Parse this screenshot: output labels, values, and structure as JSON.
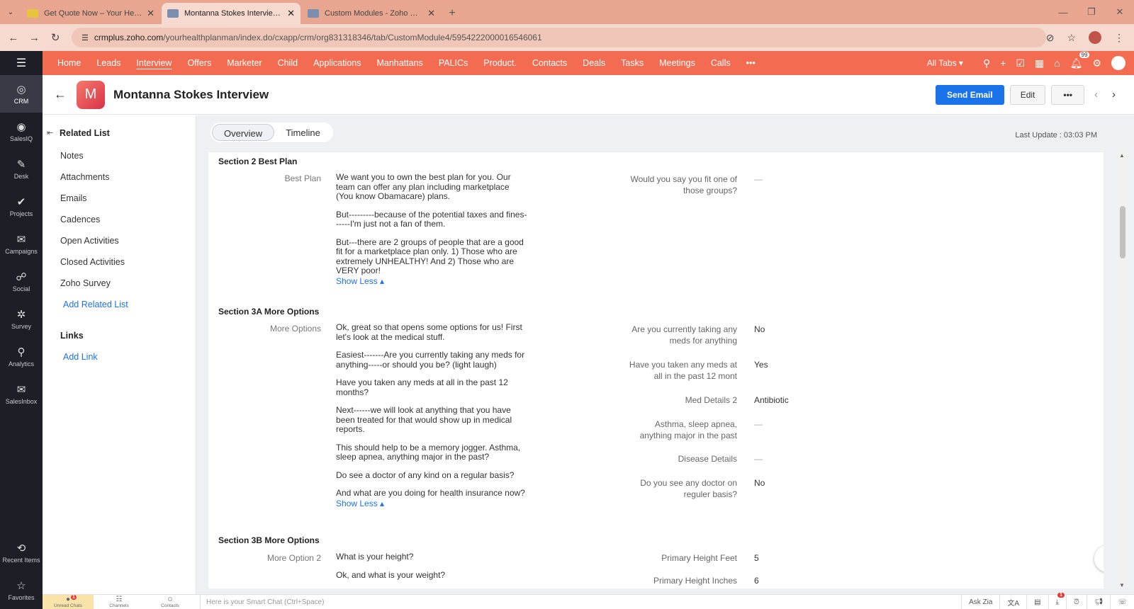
{
  "browser": {
    "tabs": [
      {
        "title": "Get Quote Now – Your Health P",
        "active": false,
        "fav_color": "#e8c33c"
      },
      {
        "title": "Montanna Stokes Interview (Int",
        "active": true,
        "fav_color": "#7a8fb0"
      },
      {
        "title": "Custom Modules - Zoho CRM",
        "active": false,
        "fav_color": "#7a8fb0"
      }
    ],
    "url_host": "crmplus.zoho.com",
    "url_path": "/yourhealthplanman/index.do/cxapp/crm/org831318346/tab/CustomModule4/5954222000016546061"
  },
  "topnav": {
    "items": [
      "Home",
      "Leads",
      "Interview",
      "Offers",
      "Marketer",
      "Child",
      "Applications",
      "Manhattans",
      "PALICs",
      "Product.",
      "Contacts",
      "Deals",
      "Tasks",
      "Meetings",
      "Calls"
    ],
    "active": "Interview",
    "more": "•••",
    "all_tabs": "All Tabs ▾",
    "notif_count": "99"
  },
  "sidebar": {
    "items": [
      {
        "label": "CRM",
        "icon": "◎",
        "active": true
      },
      {
        "label": "SalesIQ",
        "icon": "◉",
        "active": false
      },
      {
        "label": "Desk",
        "icon": "✎",
        "active": false
      },
      {
        "label": "Projects",
        "icon": "✔",
        "active": false
      },
      {
        "label": "Campaigns",
        "icon": "✉",
        "active": false
      },
      {
        "label": "Social",
        "icon": "☍",
        "active": false
      },
      {
        "label": "Survey",
        "icon": "✲",
        "active": false
      },
      {
        "label": "Analytics",
        "icon": "⚲",
        "active": false
      },
      {
        "label": "SalesInbox",
        "icon": "✉",
        "active": false
      }
    ],
    "bottom": [
      {
        "label": "Recent Items",
        "icon": "⟲"
      },
      {
        "label": "Favorites",
        "icon": "☆"
      }
    ]
  },
  "record": {
    "avatar_letter": "M",
    "title": "Montanna Stokes Interview",
    "send_email": "Send Email",
    "edit": "Edit",
    "more": "•••"
  },
  "related": {
    "title": "Related List",
    "items": [
      "Notes",
      "Attachments",
      "Emails",
      "Cadences",
      "Open Activities",
      "Closed Activities",
      "Zoho Survey"
    ],
    "add_related": "Add Related List",
    "links_title": "Links",
    "add_link": "Add Link"
  },
  "view_tabs": {
    "overview": "Overview",
    "timeline": "Timeline"
  },
  "last_update": "Last Update : 03:03 PM",
  "sections": {
    "s2": {
      "title": "Section 2 Best Plan",
      "label": "Best Plan",
      "paras": [
        "We want you to own the best plan for you. Our team can offer any plan including marketplace (You know Obamacare) plans.",
        "But---------because of the potential taxes and fines------I'm just not a fan of them.",
        "But---there are 2 groups of people that are a good fit for a marketplace plan only. 1) Those who are extremely UNHEALTHY! And 2) Those who are VERY poor!"
      ],
      "show_less": "Show Less ▴",
      "right": [
        {
          "label": "Would you say you fit one of those groups?",
          "value": "—"
        }
      ]
    },
    "s3a": {
      "title": "Section 3A More Options",
      "label": "More Options",
      "paras": [
        "Ok, great so that opens some options for us! First let's look at the medical stuff.",
        "Easiest-------Are you currently taking any meds for anything-----or should you be? (light laugh)",
        "Have you taken any meds at all in the past 12 months?",
        "Next------we will look at anything that you have been treated for that would show up in medical reports.",
        "This should help to be a memory jogger. Asthma, sleep apnea, anything major in the past?",
        "Do see a doctor of any kind on a regular basis?",
        "And what are you doing for health insurance now?"
      ],
      "show_less": "Show Less ▴",
      "right": [
        {
          "label": "Are you currently taking any meds for anything",
          "value": "No"
        },
        {
          "label": "Have you taken any meds at all in the past 12 mont",
          "value": "Yes"
        },
        {
          "label": "Med Details 2",
          "value": "Antibiotic"
        },
        {
          "label": "Asthma, sleep apnea, anything major in the past",
          "value": "—"
        },
        {
          "label": "Disease Details",
          "value": "—"
        },
        {
          "label": "Do you see any doctor on reguler basis?",
          "value": "No"
        }
      ]
    },
    "s3b": {
      "title": "Section 3B More Options",
      "label": "More Option 2",
      "paras": [
        "What is your height?",
        "Ok, and what is your weight?"
      ],
      "right": [
        {
          "label": "Primary Height Feet",
          "value": "5"
        },
        {
          "label": "Primary Height Inches",
          "value": "6"
        }
      ]
    }
  },
  "bottombar": {
    "items": [
      {
        "label": "Unread Chats",
        "icon": "●",
        "count": "1",
        "active": true
      },
      {
        "label": "Channels",
        "icon": "☷",
        "count": "",
        "active": false
      },
      {
        "label": "Contacts",
        "icon": "☺",
        "count": "",
        "active": false
      }
    ],
    "smart_chat": "Here is your Smart Chat (Ctrl+Space)",
    "ask_zia": "Ask Zia",
    "download_count": "1"
  }
}
